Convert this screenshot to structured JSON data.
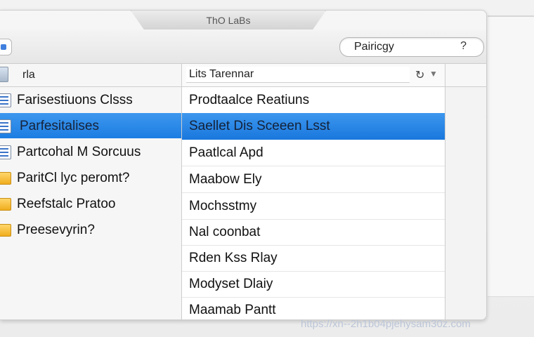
{
  "window": {
    "title": "ThO LaBs"
  },
  "search": {
    "value": "Pairicgy",
    "help_icon": "?"
  },
  "sidebar": {
    "header_label": "rla",
    "items": [
      {
        "label": "Farisestiuons Clsss",
        "icon": "list-icon"
      },
      {
        "label": "Parfesitalises",
        "icon": "list-icon",
        "selected": true
      },
      {
        "label": "Partcohal M Sorcuus",
        "icon": "list-icon"
      },
      {
        "label": "ParitCl lyc peromt?",
        "icon": "folder-icon"
      },
      {
        "label": "Reefstalc Pratoo",
        "icon": "folder-icon"
      },
      {
        "label": "Preesevyrin?",
        "icon": "folder-icon"
      }
    ]
  },
  "list": {
    "filter_value": "Lits Tarennar",
    "items": [
      {
        "label": "Prodtaalce Reatiuns"
      },
      {
        "label": "Saellet Dis Sceeen Lsst",
        "selected": true
      },
      {
        "label": "Paatlcal Apd"
      },
      {
        "label": "Maabow Ely"
      },
      {
        "label": "Mochsstmy"
      },
      {
        "label": "Nal coonbat"
      },
      {
        "label": "Rden Kss Rlay"
      },
      {
        "label": "Modyset Dlaiy"
      },
      {
        "label": "Maamab Pantt"
      }
    ]
  },
  "watermark": "https://xn--2h1b04pjehysam30z.com",
  "colors": {
    "selection": "#2588e8",
    "folder": "#f5b72e"
  }
}
